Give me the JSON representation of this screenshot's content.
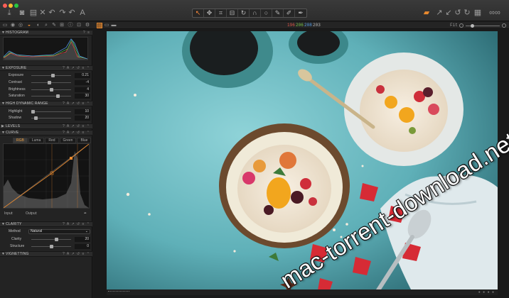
{
  "window": {
    "traffic_lights": [
      "#fe5f57",
      "#febc2e",
      "#28c840"
    ]
  },
  "toolbar": {
    "left_icons": [
      "import-icon",
      "camera-icon",
      "export-icon",
      "delete-icon",
      "undo-icon",
      "redo-icon",
      "text-icon"
    ],
    "cursor_tools": [
      "pointer-tool-icon",
      "pan-tool-icon",
      "crop-tool-icon",
      "straighten-tool-icon",
      "rotate-tool-icon",
      "keystone-tool-icon",
      "spot-tool-icon",
      "brush-tool-icon",
      "eraser-tool-icon",
      "picker-tool-icon"
    ],
    "right_icons": [
      "workspace-icon",
      "copy-adjustments-icon",
      "apply-adjustments-icon",
      "reset-icon",
      "rotate-cw-icon",
      "grid-icon",
      "glasses-icon"
    ]
  },
  "subbar": {
    "rgb_readout": [
      "196",
      "206",
      "208",
      "203"
    ],
    "rgb_colors": [
      "#e0584c",
      "#7cc84a",
      "#5aa0e8",
      "#bbbbbb"
    ],
    "zoom_label": "Fit"
  },
  "panels": {
    "histogram": {
      "title": "HISTOGRAM"
    },
    "exposure": {
      "title": "EXPOSURE",
      "rows": [
        {
          "label": "Exposure",
          "value": "0.21",
          "level": 0.55
        },
        {
          "label": "Contrast",
          "value": "-4",
          "level": 0.45
        },
        {
          "label": "Brightness",
          "value": "4",
          "level": 0.52
        },
        {
          "label": "Saturation",
          "value": "30",
          "level": 0.65
        }
      ]
    },
    "hdr": {
      "title": "HIGH DYNAMIC RANGE",
      "rows": [
        {
          "label": "Highlight",
          "value": "10",
          "level": 0.05
        },
        {
          "label": "Shadow",
          "value": "20",
          "level": 0.1
        }
      ]
    },
    "levels": {
      "title": "LEVELS"
    },
    "curve": {
      "title": "CURVE",
      "tabs": [
        "RGB",
        "Luma",
        "Red",
        "Green",
        "Blue"
      ],
      "active_tab": "RGB",
      "input_label": "Input:",
      "output_label": "Output:"
    },
    "clarity": {
      "title": "CLARITY",
      "method_label": "Method",
      "method_value": "Natural",
      "rows": [
        {
          "label": "Clarity",
          "value": "20",
          "level": 0.6
        },
        {
          "label": "Structure",
          "value": "0",
          "level": 0.5
        }
      ]
    },
    "vignetting": {
      "title": "VIGNETTING"
    }
  },
  "watermark": {
    "text": "mac-torrent-download.net"
  }
}
